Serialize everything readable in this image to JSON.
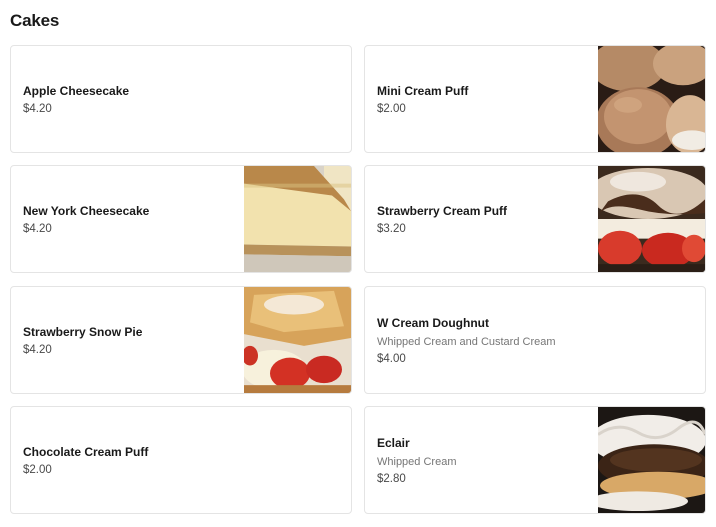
{
  "section": {
    "title": "Cakes"
  },
  "items": [
    {
      "name": "Apple Cheesecake",
      "price": "$4.20",
      "image": ""
    },
    {
      "name": "Mini Cream Puff",
      "price": "$2.00",
      "image": "cream-puff-photo"
    },
    {
      "name": "New York Cheesecake",
      "price": "$4.20",
      "image": "cheesecake-photo"
    },
    {
      "name": "Strawberry Cream Puff",
      "price": "$3.20",
      "image": "strawberry-cream-puff-photo"
    },
    {
      "name": "Strawberry Snow Pie",
      "price": "$4.20",
      "image": "strawberry-snow-pie-photo"
    },
    {
      "name": "W Cream Doughnut",
      "description": "Whipped Cream and Custard Cream",
      "price": "$4.00",
      "image": ""
    },
    {
      "name": "Chocolate Cream Puff",
      "price": "$2.00",
      "image": ""
    },
    {
      "name": "Eclair",
      "description": "Whipped Cream",
      "price": "$2.80",
      "image": "eclair-photo"
    }
  ]
}
